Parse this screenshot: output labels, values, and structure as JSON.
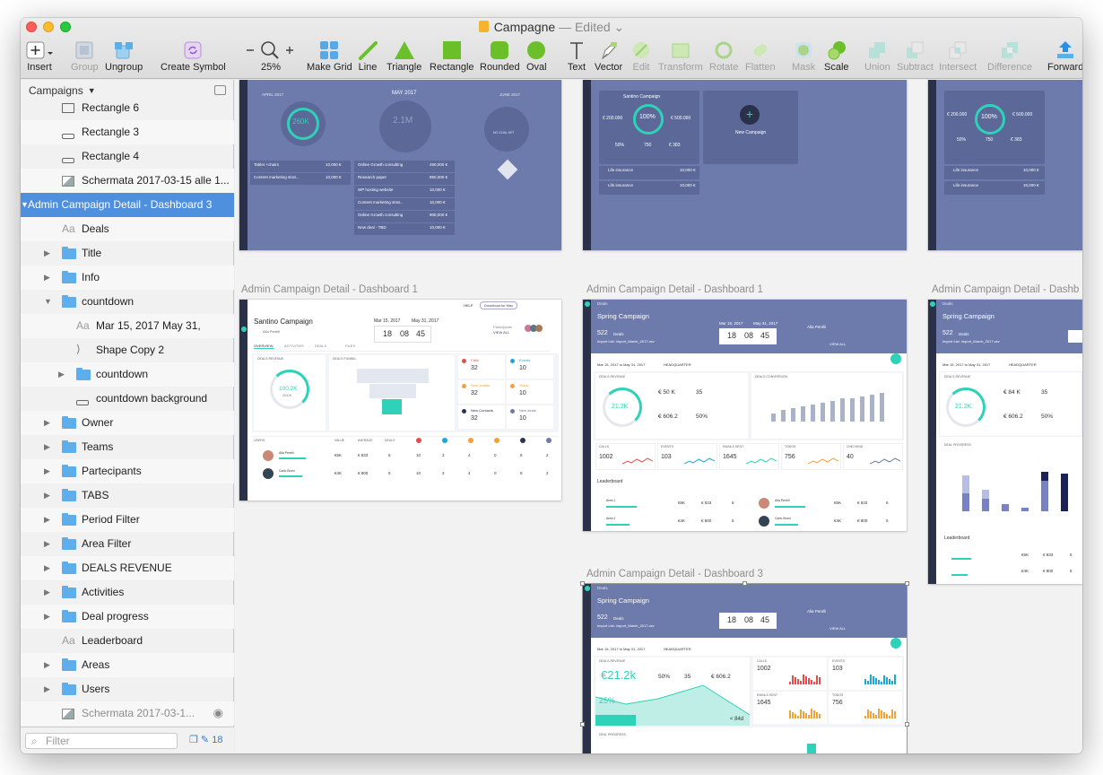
{
  "window": {
    "title": "Campagne",
    "status": "Edited"
  },
  "toolbar": {
    "insert": "Insert",
    "group": "Group",
    "ungroup": "Ungroup",
    "create_symbol": "Create Symbol",
    "zoom": "25%",
    "make_grid": "Make Grid",
    "line": "Line",
    "triangle": "Triangle",
    "rectangle": "Rectangle",
    "rounded": "Rounded",
    "oval": "Oval",
    "text": "Text",
    "vector": "Vector",
    "edit": "Edit",
    "transform": "Transform",
    "rotate": "Rotate",
    "flatten": "Flatten",
    "mask": "Mask",
    "scale": "Scale",
    "union": "Union",
    "subtract": "Subtract",
    "intersect": "Intersect",
    "difference": "Difference",
    "forward": "Forward"
  },
  "sidebar": {
    "page": "Campaigns",
    "layers": [
      {
        "label": "Rectangle 6"
      },
      {
        "label": "Rectangle 3"
      },
      {
        "label": "Rectangle 4"
      },
      {
        "label": "Schermata 2017-03-15 alle 1..."
      },
      {
        "label": "Admin Campaign Detail - Dashboard 3"
      },
      {
        "label": "Deals"
      },
      {
        "label": "Title"
      },
      {
        "label": "Info"
      },
      {
        "label": "countdown"
      },
      {
        "label": "Mar 15, 2017 May 31,"
      },
      {
        "label": "Shape Copy 2"
      },
      {
        "label": "countdown"
      },
      {
        "label": "countdown background"
      },
      {
        "label": "Owner"
      },
      {
        "label": "Teams"
      },
      {
        "label": "Partecipants"
      },
      {
        "label": "TABS"
      },
      {
        "label": "Period Filter"
      },
      {
        "label": "Area Filter"
      },
      {
        "label": "DEALS REVENUE"
      },
      {
        "label": "Activities"
      },
      {
        "label": "Deal progress"
      },
      {
        "label": "Leaderboard"
      },
      {
        "label": "Areas"
      },
      {
        "label": "Users"
      },
      {
        "label": "Schermata 2017-03-1..."
      }
    ],
    "filter_placeholder": "Filter",
    "count": "18"
  },
  "canvas": {
    "artboards": [
      {
        "label": "Admin Campaign Detail - Dashboard 1"
      },
      {
        "label": "Admin Campaign Detail - Dashboard 1"
      },
      {
        "label": "Admin Campaign Detail - Dashb"
      },
      {
        "label": "Admin Campaign Detail - Dashboard 3"
      }
    ],
    "top_row": {
      "a": {
        "month_prev": "APRIL 2017",
        "month": "MAY 2017",
        "month_next": "JUNE 2017",
        "goal": "260K",
        "goal_sub": "/300K",
        "mid": "2.1M",
        "no_goal": "NO GOAL SET",
        "rows": [
          "Tablet +chairs",
          "Content marketing strat...",
          "Online Growth consulting",
          "Research paper",
          "WP hosting website",
          "Content marketing strat...",
          "Online Growth consulting",
          "New deal - TBD"
        ],
        "amounts": [
          "10,000 €",
          "10,000 €",
          "450,000 €",
          "850,000 €",
          "10,000 €",
          "10,000 €",
          "900,000 €",
          "10,000 €"
        ]
      },
      "b": {
        "campaign": "Santino Campaign",
        "pct": "100%",
        "pipeline": "€ 200.000",
        "value": "€ 500.000",
        "v1": "50%",
        "v2": "750",
        "v3": "€ 383",
        "new_campaign": "New Campaign",
        "li1": "Life insurance",
        "li_amt": "10,000 €"
      },
      "c": {
        "pipeline": "€ 200.000",
        "pct": "100%",
        "value": "€ 500.000",
        "v1": "50%",
        "v2": "750",
        "v3": "€ 383",
        "li1": "Life insurance",
        "li_amt": "10,000 €"
      }
    },
    "d1a": {
      "campaign": "Santino Campaign",
      "owner": "Alia Perelli",
      "date_from": "Mar 15, 2017",
      "date_to": "May 31, 2017",
      "cd": [
        "18",
        "08",
        "45"
      ],
      "participants": "Participants",
      "view_all": "VIEW ALL",
      "tabs": [
        "OVERVIEW",
        "ACTIVITIES",
        "DEALS",
        "FILES"
      ],
      "revenue_title": "DEALS REVENUE",
      "funnel_title": "DEALS FUNNEL",
      "ring": "100.2K",
      "ring_sub": "/500K",
      "kpis": [
        {
          "name": "Calls",
          "value": "32",
          "color": "#e44d4d"
        },
        {
          "name": "Events",
          "value": "10",
          "color": "#1ea7d6"
        },
        {
          "name": "Sent emails",
          "value": "32",
          "color": "#f1a23a"
        },
        {
          "name": "Todos",
          "value": "10",
          "color": "#f1a23a"
        },
        {
          "name": "New Contacts",
          "value": "32",
          "color": "#2b3350"
        },
        {
          "name": "New deals",
          "value": "10",
          "color": "#6c7aa8"
        }
      ],
      "table_head": [
        "USERS",
        "VALUE",
        "AVERAGE",
        "DEALS"
      ],
      "rows": [
        {
          "name": "Alia Perelli",
          "value": "€5K",
          "avg": "€ 833",
          "deals": "6",
          "c": [
            "10",
            "3",
            "4",
            "0",
            "6",
            "2"
          ]
        },
        {
          "name": "Carlo Bruni",
          "value": "€4K",
          "avg": "€ 800",
          "deals": "5",
          "c": [
            "10",
            "3",
            "4",
            "0",
            "6",
            "2"
          ]
        }
      ],
      "help": "HELP",
      "download": "Download for Mac"
    },
    "d1b": {
      "section": "Deals",
      "campaign": "Spring Campaign",
      "deals": "522",
      "deals_lbl": "Deals",
      "import": "Import List: import_March_2017.csv",
      "date_from": "Mar 15, 2017",
      "date_to": "May 31, 2017",
      "cd": [
        "18",
        "08",
        "45"
      ],
      "owner": "Alia Perelli",
      "view_all": "VIEW ALL",
      "period": "Mar 15, 2017 to May 31, 2017",
      "area": "HEADQUARTER",
      "revenue": "DEALS REVENUE",
      "ring": "21.2K",
      "goal": "€ 50 K",
      "won": "35",
      "avg": "€ 606.2",
      "win_rate": "50%",
      "conv": "DEALS CONVERSION",
      "bars": [
        4,
        6,
        7,
        8,
        9,
        10,
        11,
        12,
        12,
        13,
        14,
        15
      ],
      "acts": [
        {
          "name": "CALLS",
          "value": "1002"
        },
        {
          "name": "EVENTS",
          "value": "103"
        },
        {
          "name": "EMAILS SENT",
          "value": "1645"
        },
        {
          "name": "TODOS",
          "value": "756"
        },
        {
          "name": "CHECKINS",
          "value": "40"
        }
      ],
      "leaderboard": "Leaderboard",
      "rows": [
        {
          "name": "Area 1",
          "value": "€5K",
          "avg": "€ 833",
          "deals": "6"
        },
        {
          "name": "Area 2",
          "value": "€4K",
          "avg": "€ 800",
          "deals": "5"
        }
      ],
      "urows": [
        {
          "name": "Alia Perelli",
          "value": "€5K",
          "avg": "€ 833",
          "deals": "6"
        },
        {
          "name": "Carlo Bruni",
          "value": "€4K",
          "avg": "€ 800",
          "deals": "5"
        }
      ]
    },
    "d3": {
      "section": "Deals",
      "campaign": "Spring Campaign",
      "deals": "522",
      "deals_lbl": "Deals",
      "import": "Import List: import_March_2017.csv",
      "cd": [
        "18",
        "08",
        "45"
      ],
      "owner": "Alia Perelli",
      "view_all": "VIEW ALL",
      "period": "Mar 15, 2017 to May 31, 2017",
      "area": "HEADQUARTER",
      "revenue": "DEALS REVENUE",
      "big": "€21.2k",
      "win_rate": "50%",
      "n_deals": "35",
      "avg": "€ 606.2",
      "pct": "25%",
      "days": "< 84d",
      "acts": [
        {
          "name": "CALLS",
          "value": "1002"
        },
        {
          "name": "EVENTS",
          "value": "103"
        },
        {
          "name": "EMAILS SENT",
          "value": "1645"
        },
        {
          "name": "TODOS",
          "value": "756"
        }
      ],
      "progress": "DEAL PROGRESS"
    },
    "d2": {
      "section": "Deals",
      "campaign": "Spring Campaign",
      "deals": "522",
      "deals_lbl": "Deals",
      "import": "Import List: import_March_2017.csv",
      "period": "Mar 15, 2017 to May 31, 2017",
      "area": "HEADQUARTER",
      "revenue": "DEALS REVENUE",
      "ring": "21.2K",
      "goal": "€ 84 K",
      "won": "35",
      "avg": "€ 606.2",
      "win_rate": "50%",
      "progress": "DEAL PROGRESS",
      "leaderboard": "Leaderboard",
      "rows": [
        {
          "value": "€5K",
          "avg": "€ 833",
          "deals": "6"
        },
        {
          "value": "€4K",
          "avg": "€ 800",
          "deals": "5"
        }
      ]
    }
  }
}
